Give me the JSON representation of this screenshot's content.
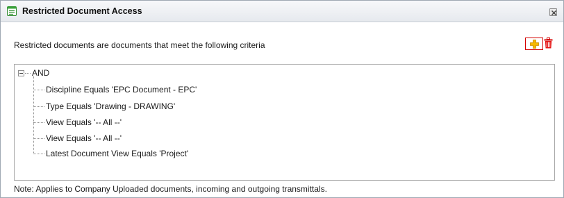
{
  "dialog": {
    "title": "Restricted Document Access"
  },
  "main": {
    "criteria_intro": "Restricted documents are documents that meet the following criteria",
    "note": "Note: Applies to Company Uploaded documents, incoming and outgoing transmittals."
  },
  "toolbar": {
    "add_icon": "plus-icon",
    "delete_icon": "trash-icon",
    "add_highlight_color": "#d40000",
    "delete_color": "#d40000"
  },
  "tree": {
    "root_label": "AND",
    "items": [
      {
        "label": "Discipline Equals 'EPC Document - EPC'"
      },
      {
        "label": "Type Equals 'Drawing - DRAWING'"
      },
      {
        "label": "View Equals '-- All --'"
      },
      {
        "label": "View Equals '-- All --'"
      },
      {
        "label": "Latest Document View Equals 'Project'"
      }
    ]
  }
}
